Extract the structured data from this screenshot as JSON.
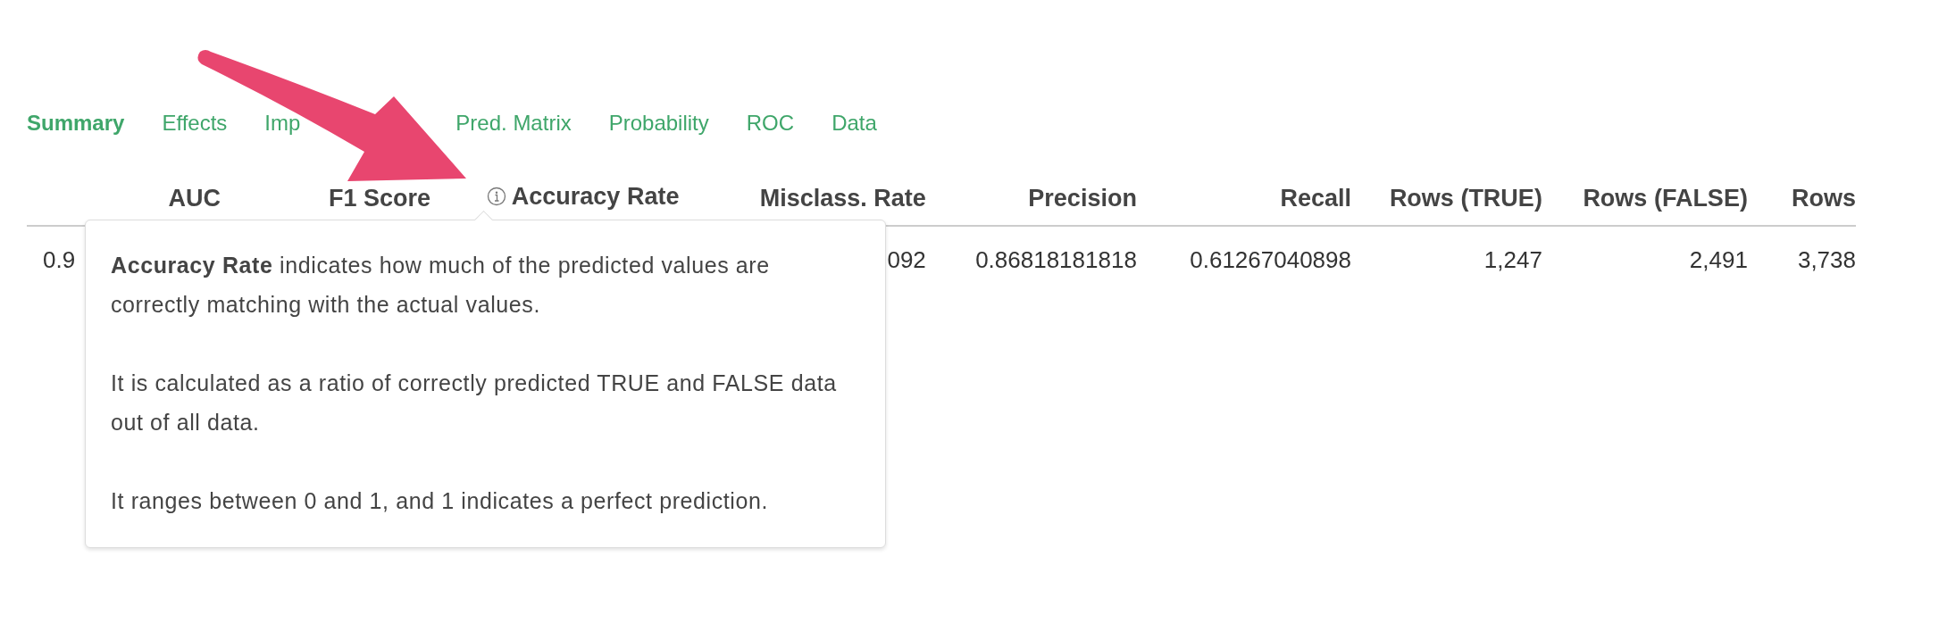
{
  "tabs": [
    {
      "label": "Summary",
      "selected": true
    },
    {
      "label": "Effects",
      "selected": false
    },
    {
      "label": "Imp",
      "selected": false
    },
    {
      "label": "Pred. Matrix",
      "selected": false
    },
    {
      "label": "Probability",
      "selected": false
    },
    {
      "label": "ROC",
      "selected": false
    },
    {
      "label": "Data",
      "selected": false
    }
  ],
  "table": {
    "columns": [
      {
        "label": "AUC",
        "info": false
      },
      {
        "label": "F1 Score",
        "info": false
      },
      {
        "label": "Accuracy Rate",
        "info": true
      },
      {
        "label": "Misclass. Rate",
        "info": false
      },
      {
        "label": "Precision",
        "info": false
      },
      {
        "label": "Recall",
        "info": false
      },
      {
        "label": "Rows (TRUE)",
        "info": false
      },
      {
        "label": "Rows (FALSE)",
        "info": false
      },
      {
        "label": "Rows",
        "info": false
      }
    ],
    "rows": [
      [
        "0.9",
        "",
        "",
        "092",
        "0.86818181818",
        "0.61267040898",
        "1,247",
        "2,491",
        "3,738"
      ]
    ]
  },
  "tooltip": {
    "paragraphs": [
      "**Accuracy Rate** indicates how much of the predicted values are correctly matching with the actual values.",
      "It is calculated as a ratio of correctly predicted TRUE and FALSE data out of all data.",
      "It ranges between 0 and 1, and 1 indicates a perfect prediction."
    ]
  }
}
